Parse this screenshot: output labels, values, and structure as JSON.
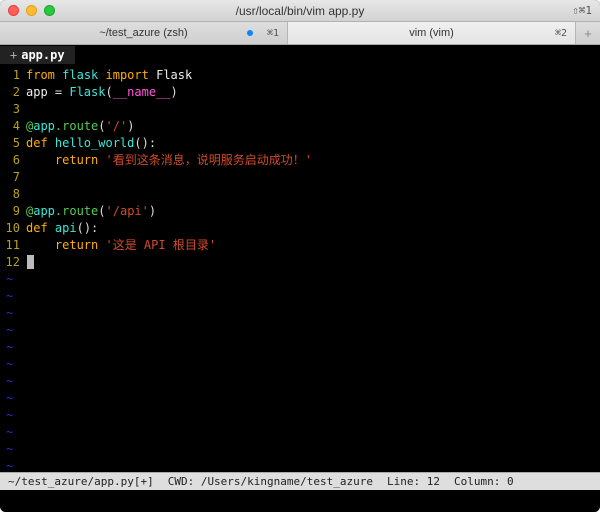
{
  "window": {
    "title": "/usr/local/bin/vim app.py",
    "shortcut_right": "⇧⌘1"
  },
  "tabs": [
    {
      "label": "~/test_azure (zsh)",
      "kb": "⌘1",
      "indicator": true
    },
    {
      "label": "vim (vim)",
      "kb": "⌘2",
      "indicator": false
    }
  ],
  "editor_tab": {
    "marker": "+",
    "filename": "app.py"
  },
  "code": {
    "l1": {
      "kw1": "from",
      "mod": "flask",
      "kw2": "import",
      "ident": "Flask"
    },
    "l2": {
      "lhs": "app ",
      "eq": "= ",
      "fn": "Flask",
      "lp": "(",
      "d": "__name__",
      "rp": ")"
    },
    "l4": {
      "at": "@",
      "obj": "app",
      "dot": ".route",
      "lp": "(",
      "s": "'/'",
      "rp": ")"
    },
    "l5": {
      "kw": "def ",
      "name": "hello_world",
      "sig": "():"
    },
    "l6": {
      "indent": "    ",
      "kw": "return ",
      "s": "'看到这条消息，说明服务启动成功！'"
    },
    "l9": {
      "at": "@",
      "obj": "app",
      "dot": ".route",
      "lp": "(",
      "s": "'/api'",
      "rp": ")"
    },
    "l10": {
      "kw": "def ",
      "name": "api",
      "sig": "():"
    },
    "l11": {
      "indent": "    ",
      "kw": "return ",
      "s": "'这是 API 根目录'"
    }
  },
  "linenos": [
    "1",
    "2",
    "3",
    "4",
    "5",
    "6",
    "7",
    "8",
    "9",
    "10",
    "11",
    "12"
  ],
  "status": {
    "path": "~/test_azure/app.py[+]",
    "cwd": "CWD: /Users/kingname/test_azure",
    "line": "Line: 12",
    "col": "Column: 0"
  },
  "tilde": "~"
}
